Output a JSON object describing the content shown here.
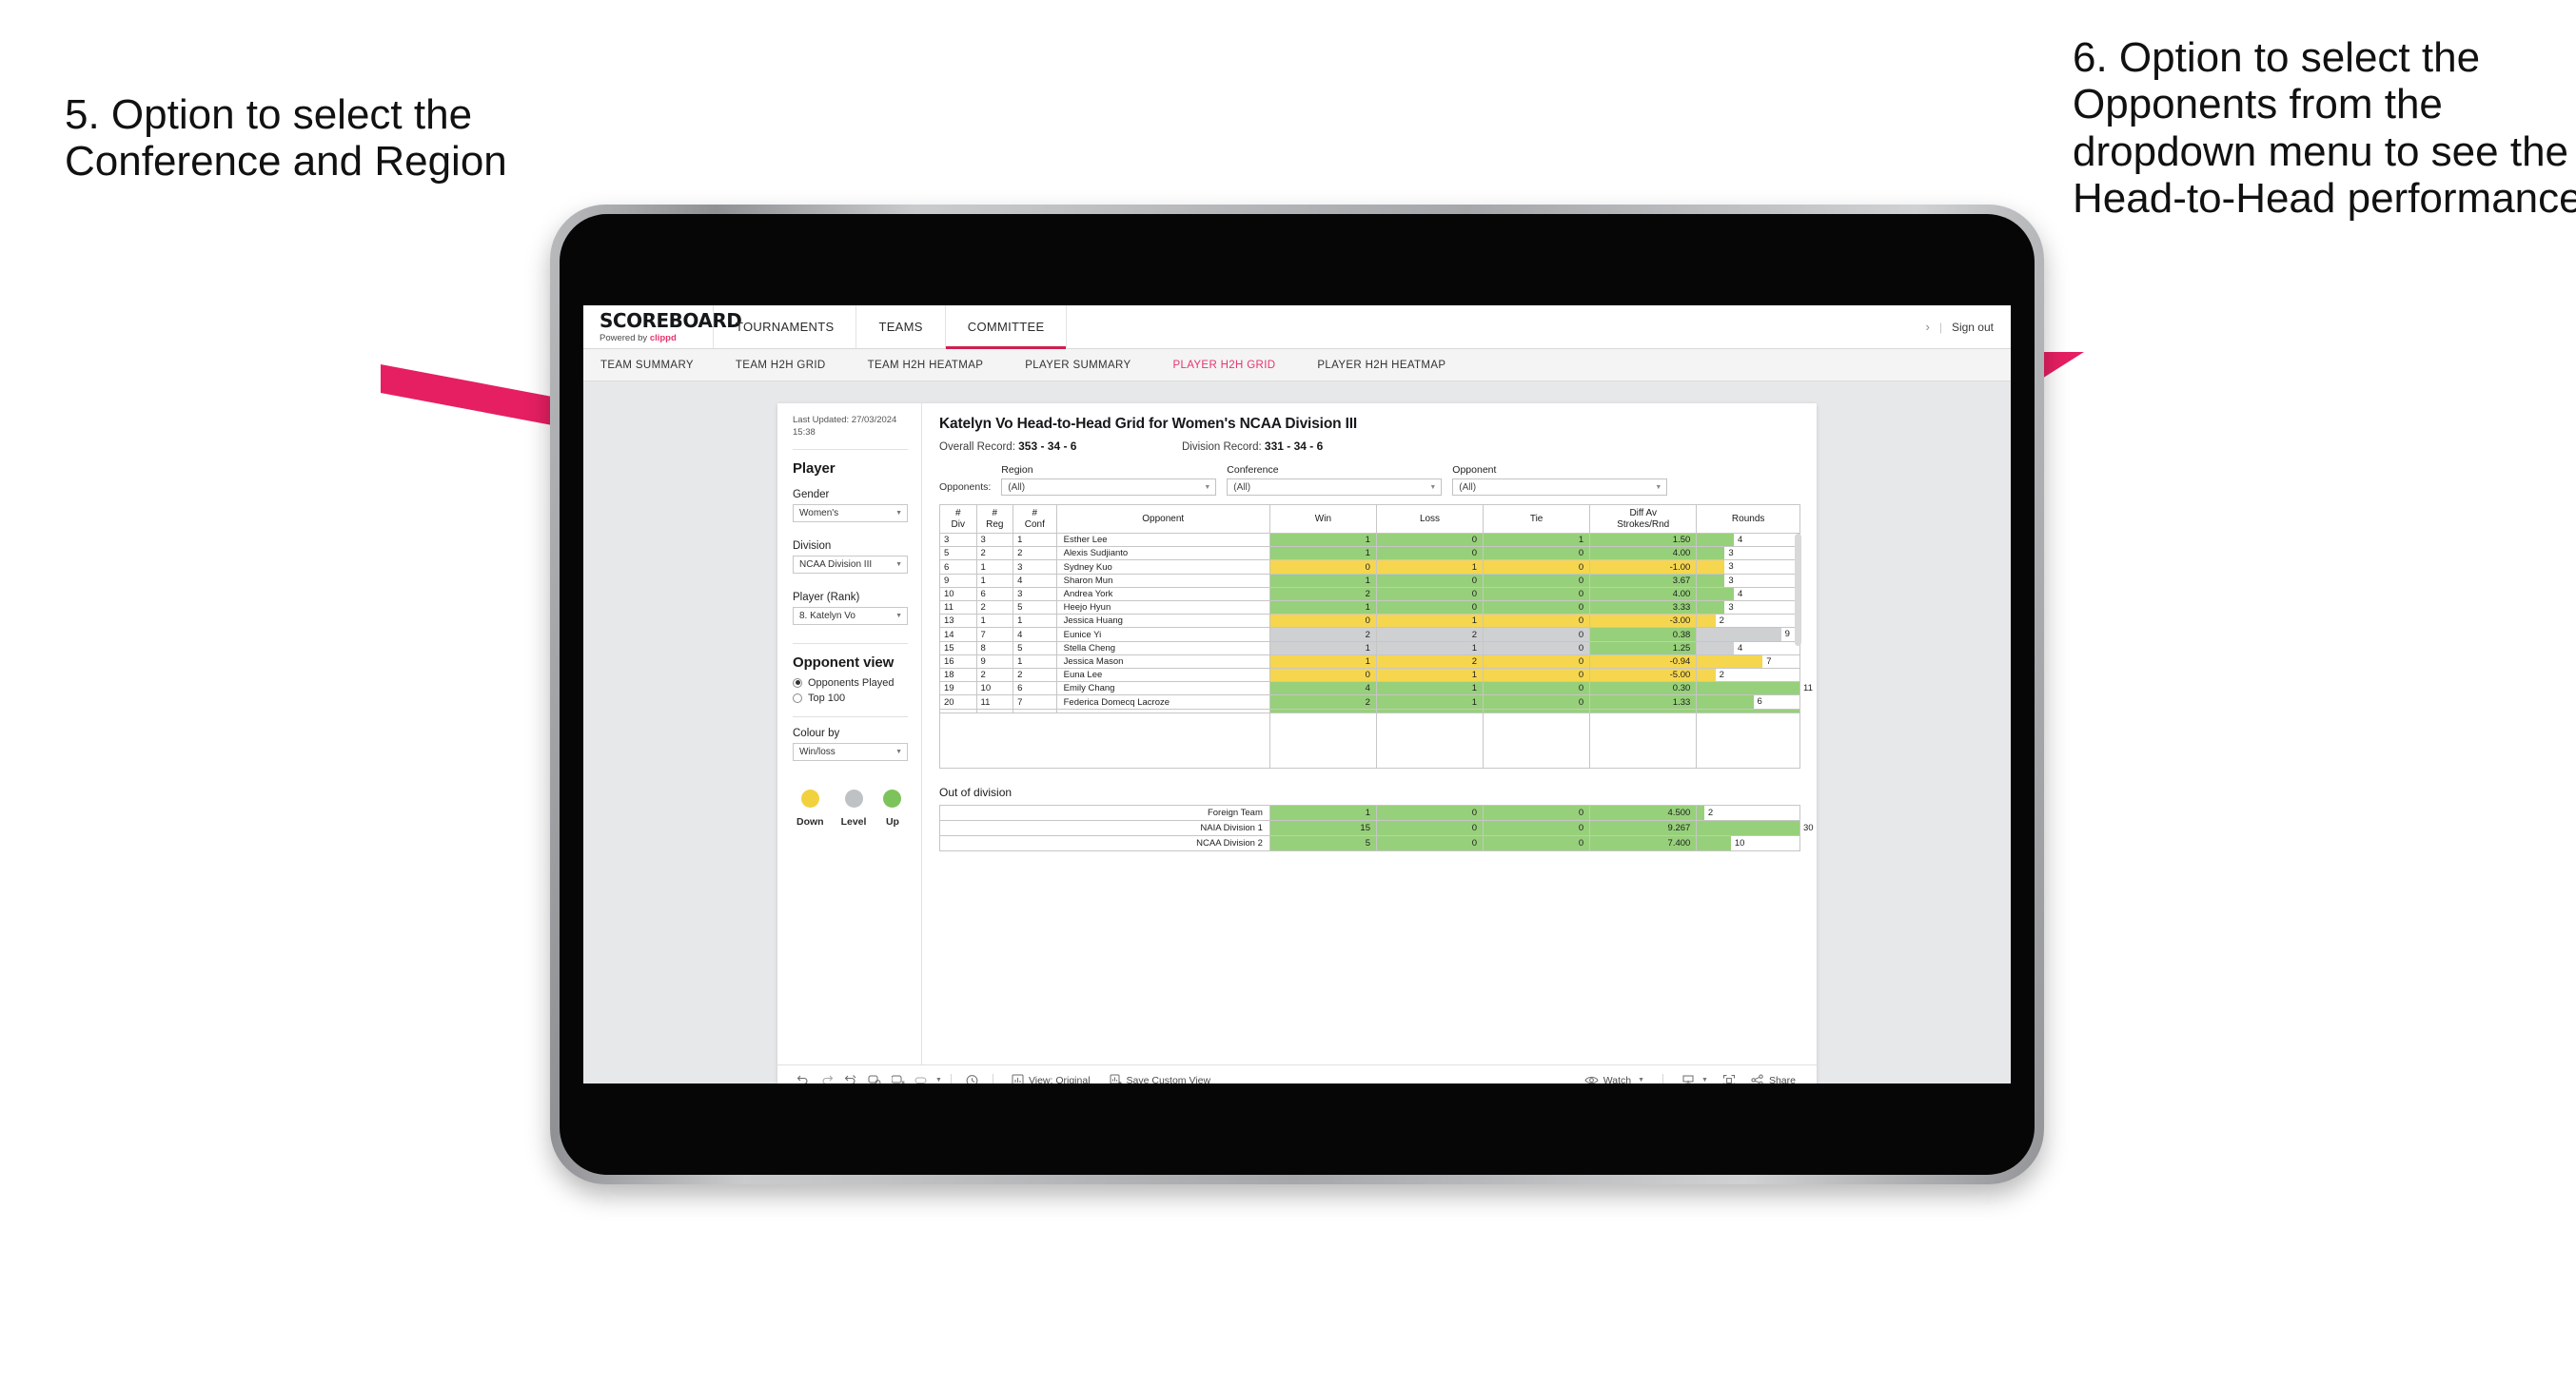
{
  "annotations": {
    "left": "5. Option to select the Conference and Region",
    "right": "6. Option to select the Opponents from the dropdown menu to see the Head-to-Head performance",
    "arrow_color": "#e51f62"
  },
  "app": {
    "brand": {
      "title": "SCOREBOARD",
      "powered_prefix": "Powered by ",
      "powered_brand": "clippd"
    },
    "topnav": [
      {
        "label": "TOURNAMENTS",
        "active": false
      },
      {
        "label": "TEAMS",
        "active": false
      },
      {
        "label": "COMMITTEE",
        "active": true
      }
    ],
    "account": {
      "chevron": "›",
      "divider": "|",
      "signout": "Sign out"
    },
    "subnav": [
      {
        "label": "TEAM SUMMARY",
        "active": false
      },
      {
        "label": "TEAM H2H GRID",
        "active": false
      },
      {
        "label": "TEAM H2H HEATMAP",
        "active": false
      },
      {
        "label": "PLAYER SUMMARY",
        "active": false
      },
      {
        "label": "PLAYER H2H GRID",
        "active": true
      },
      {
        "label": "PLAYER H2H HEATMAP",
        "active": false
      }
    ]
  },
  "sidebar": {
    "last_updated": "Last Updated: 27/03/2024\n15:38",
    "heading": "Player",
    "fields": [
      {
        "label": "Gender",
        "value": "Women's"
      },
      {
        "label": "Division",
        "value": "NCAA Division III"
      },
      {
        "label": "Player (Rank)",
        "value": "8. Katelyn Vo"
      }
    ],
    "opponent_view": {
      "heading": "Opponent view",
      "options": [
        {
          "label": "Opponents Played",
          "selected": true
        },
        {
          "label": "Top 100",
          "selected": false
        }
      ]
    },
    "colour_by": {
      "label": "Colour by",
      "value": "Win/loss"
    },
    "legend": [
      {
        "label": "Down",
        "color": "#f2d13e"
      },
      {
        "label": "Level",
        "color": "#bfc2c5"
      },
      {
        "label": "Up",
        "color": "#7dc35b"
      }
    ]
  },
  "main": {
    "title": "Katelyn Vo Head-to-Head Grid for Women's NCAA Division III",
    "overall_record_label": "Overall Record: ",
    "overall_record_value": "353 -  34 - 6",
    "division_record_label": "Division Record: ",
    "division_record_value": "331 -  34 - 6",
    "filters_label": "Opponents:",
    "filters": [
      {
        "label": "Region",
        "value": "(All)"
      },
      {
        "label": "Conference",
        "value": "(All)"
      },
      {
        "label": "Opponent",
        "value": "(All)"
      }
    ],
    "grid_headers": [
      "#\nDiv",
      "#\nReg",
      "#\nConf",
      "Opponent",
      "Win",
      "Loss",
      "Tie",
      "Diff Av\nStrokes/Rnd",
      "Rounds"
    ],
    "grid_rows": [
      {
        "div": "3",
        "reg": "3",
        "conf": "1",
        "opponent": "Esther Lee",
        "win": "1",
        "loss": "0",
        "tie": "1",
        "diff": "1.50",
        "rounds": "4",
        "tone": "up",
        "bar_pct": 36
      },
      {
        "div": "5",
        "reg": "2",
        "conf": "2",
        "opponent": "Alexis Sudjianto",
        "win": "1",
        "loss": "0",
        "tie": "0",
        "diff": "4.00",
        "rounds": "3",
        "tone": "up",
        "bar_pct": 27
      },
      {
        "div": "6",
        "reg": "1",
        "conf": "3",
        "opponent": "Sydney Kuo",
        "win": "0",
        "loss": "1",
        "tie": "0",
        "diff": "-1.00",
        "rounds": "3",
        "tone": "down",
        "bar_pct": 27
      },
      {
        "div": "9",
        "reg": "1",
        "conf": "4",
        "opponent": "Sharon Mun",
        "win": "1",
        "loss": "0",
        "tie": "0",
        "diff": "3.67",
        "rounds": "3",
        "tone": "up",
        "bar_pct": 27
      },
      {
        "div": "10",
        "reg": "6",
        "conf": "3",
        "opponent": "Andrea York",
        "win": "2",
        "loss": "0",
        "tie": "0",
        "diff": "4.00",
        "rounds": "4",
        "tone": "up",
        "bar_pct": 36
      },
      {
        "div": "11",
        "reg": "2",
        "conf": "5",
        "opponent": "Heejo Hyun",
        "win": "1",
        "loss": "0",
        "tie": "0",
        "diff": "3.33",
        "rounds": "3",
        "tone": "up",
        "bar_pct": 27
      },
      {
        "div": "13",
        "reg": "1",
        "conf": "1",
        "opponent": "Jessica Huang",
        "win": "0",
        "loss": "1",
        "tie": "0",
        "diff": "-3.00",
        "rounds": "2",
        "tone": "down",
        "bar_pct": 18
      },
      {
        "div": "14",
        "reg": "7",
        "conf": "4",
        "opponent": "Eunice Yi",
        "win": "2",
        "loss": "2",
        "tie": "0",
        "diff": "0.38",
        "rounds": "9",
        "tone": "level",
        "diff_tone": "up",
        "bar_pct": 82
      },
      {
        "div": "15",
        "reg": "8",
        "conf": "5",
        "opponent": "Stella Cheng",
        "win": "1",
        "loss": "1",
        "tie": "0",
        "diff": "1.25",
        "rounds": "4",
        "tone": "level",
        "diff_tone": "up",
        "bar_pct": 36
      },
      {
        "div": "16",
        "reg": "9",
        "conf": "1",
        "opponent": "Jessica Mason",
        "win": "1",
        "loss": "2",
        "tie": "0",
        "diff": "-0.94",
        "rounds": "7",
        "tone": "down",
        "bar_pct": 64
      },
      {
        "div": "18",
        "reg": "2",
        "conf": "2",
        "opponent": "Euna Lee",
        "win": "0",
        "loss": "1",
        "tie": "0",
        "diff": "-5.00",
        "rounds": "2",
        "tone": "down",
        "bar_pct": 18
      },
      {
        "div": "19",
        "reg": "10",
        "conf": "6",
        "opponent": "Emily Chang",
        "win": "4",
        "loss": "1",
        "tie": "0",
        "diff": "0.30",
        "rounds": "11",
        "tone": "up",
        "bar_pct": 100
      },
      {
        "div": "20",
        "reg": "11",
        "conf": "7",
        "opponent": "Federica Domecq Lacroze",
        "win": "2",
        "loss": "1",
        "tie": "0",
        "diff": "1.33",
        "rounds": "6",
        "tone": "up",
        "bar_pct": 55
      }
    ],
    "out_of_division": {
      "title": "Out of division",
      "rows": [
        {
          "name": "Foreign Team",
          "win": "1",
          "loss": "0",
          "tie": "0",
          "diff": "4.500",
          "rounds": "2",
          "tone": "up",
          "bar_pct": 7
        },
        {
          "name": "NAIA Division 1",
          "win": "15",
          "loss": "0",
          "tie": "0",
          "diff": "9.267",
          "rounds": "30",
          "tone": "up",
          "bar_pct": 100
        },
        {
          "name": "NCAA Division 2",
          "win": "5",
          "loss": "0",
          "tie": "0",
          "diff": "7.400",
          "rounds": "10",
          "tone": "up",
          "bar_pct": 33
        }
      ]
    }
  },
  "toolbar": {
    "icons": [
      "undo-icon",
      "redo-icon",
      "revert-icon",
      "refresh-icon",
      "pause-icon",
      "pill-icon"
    ],
    "view_label": "View: Original",
    "save_label": "Save Custom View",
    "watch_label": "Watch",
    "share_label": "Share",
    "download_icon": "download-icon",
    "fullscreen_icon": "fullscreen-icon",
    "alert_icon": "alert-icon"
  }
}
